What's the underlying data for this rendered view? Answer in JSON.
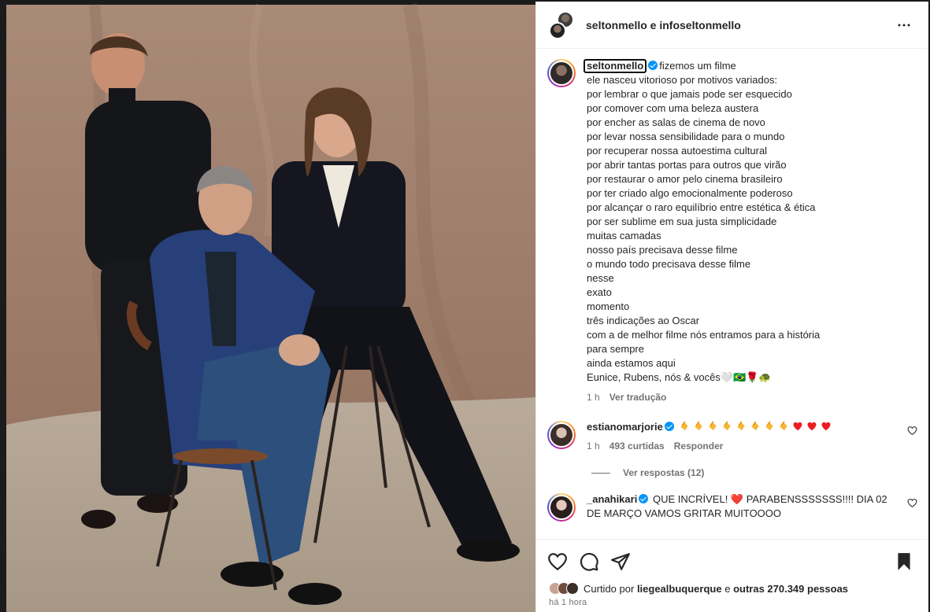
{
  "header": {
    "names": "seltonmello e infoseltonmello"
  },
  "caption": {
    "username": "seltonmello",
    "first_line": "fizemos um filme",
    "lines": [
      "ele nasceu vitorioso por motivos variados:",
      "por lembrar o que jamais pode ser esquecido",
      "por comover com uma beleza austera",
      "por encher as salas de cinema de novo",
      "por levar nossa sensibilidade para o mundo",
      "por recuperar nossa autoestima cultural",
      "por abrir tantas portas para outros que virão",
      "por restaurar o amor pelo cinema brasileiro",
      "por ter criado algo emocionalmente poderoso",
      "por alcançar o raro equilíbrio entre estética & ética",
      "por ser sublime em sua justa simplicidade",
      "muitas camadas",
      "nosso país precisava desse filme",
      "o mundo todo precisava desse filme",
      "nesse",
      "exato",
      "momento",
      "três indicações ao Oscar",
      "com a de melhor filme nós entramos para a história",
      "para sempre",
      "ainda estamos aqui",
      "Eunice, Rubens, nós & vocês🤍🇧🇷🌹🐢"
    ],
    "time": "1 h",
    "translate": "Ver tradução"
  },
  "comments": [
    {
      "username": "estianomarjorie",
      "text": "",
      "time": "1 h",
      "likes": "493 curtidas",
      "reply": "Responder",
      "view_replies": "Ver respostas (12)"
    },
    {
      "username": "_anahikari",
      "text": "QUE INCRÍVEL! ❤️ PARABENSSSSSSS!!!! DIA 02 DE MARÇO VAMOS GRITAR MUITOOOO"
    }
  ],
  "likes": {
    "prefix": "Curtido por",
    "user": "liegealbuquerque",
    "connector": "e",
    "others": "outras 270.349 pessoas"
  },
  "post_time": "há 1 hora",
  "icons": {
    "more": "more-horizontal-icon",
    "like": "heart-outline-icon",
    "comment": "comment-bubble-icon",
    "share": "share-paper-plane-icon",
    "save": "bookmark-filled-icon"
  },
  "colors": {
    "verified": "#0095f6",
    "text": "#262626",
    "muted": "#737373",
    "heart": "#ed1c24"
  }
}
